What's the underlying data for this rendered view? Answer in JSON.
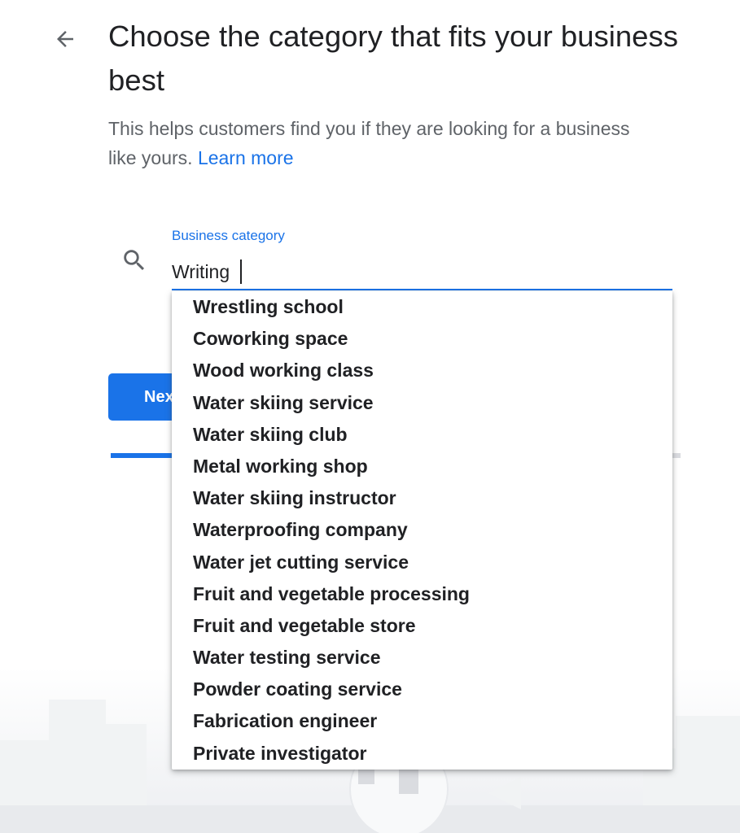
{
  "header": {
    "title": "Choose the category that fits your business best",
    "subtitle": "This helps customers find you if they are looking for a business like yours.",
    "learn_more": "Learn more"
  },
  "search": {
    "label": "Business category",
    "value": "Writing"
  },
  "next_button": {
    "label": "Next"
  },
  "progress": {
    "fraction": 0.107
  },
  "suggestions": [
    "Wrestling school",
    "Coworking space",
    "Wood working class",
    "Water skiing service",
    "Water skiing club",
    "Metal working shop",
    "Water skiing instructor",
    "Waterproofing company",
    "Water jet cutting service",
    "Fruit and vegetable processing",
    "Fruit and vegetable store",
    "Water testing service",
    "Powder coating service",
    "Fabrication engineer",
    "Private investigator"
  ],
  "colors": {
    "accent": "#1a73e8",
    "text_primary": "#202124",
    "text_secondary": "#5f6368",
    "track": "#dadce0"
  },
  "icons": {
    "back": "arrow-back-icon",
    "search": "search-icon"
  }
}
